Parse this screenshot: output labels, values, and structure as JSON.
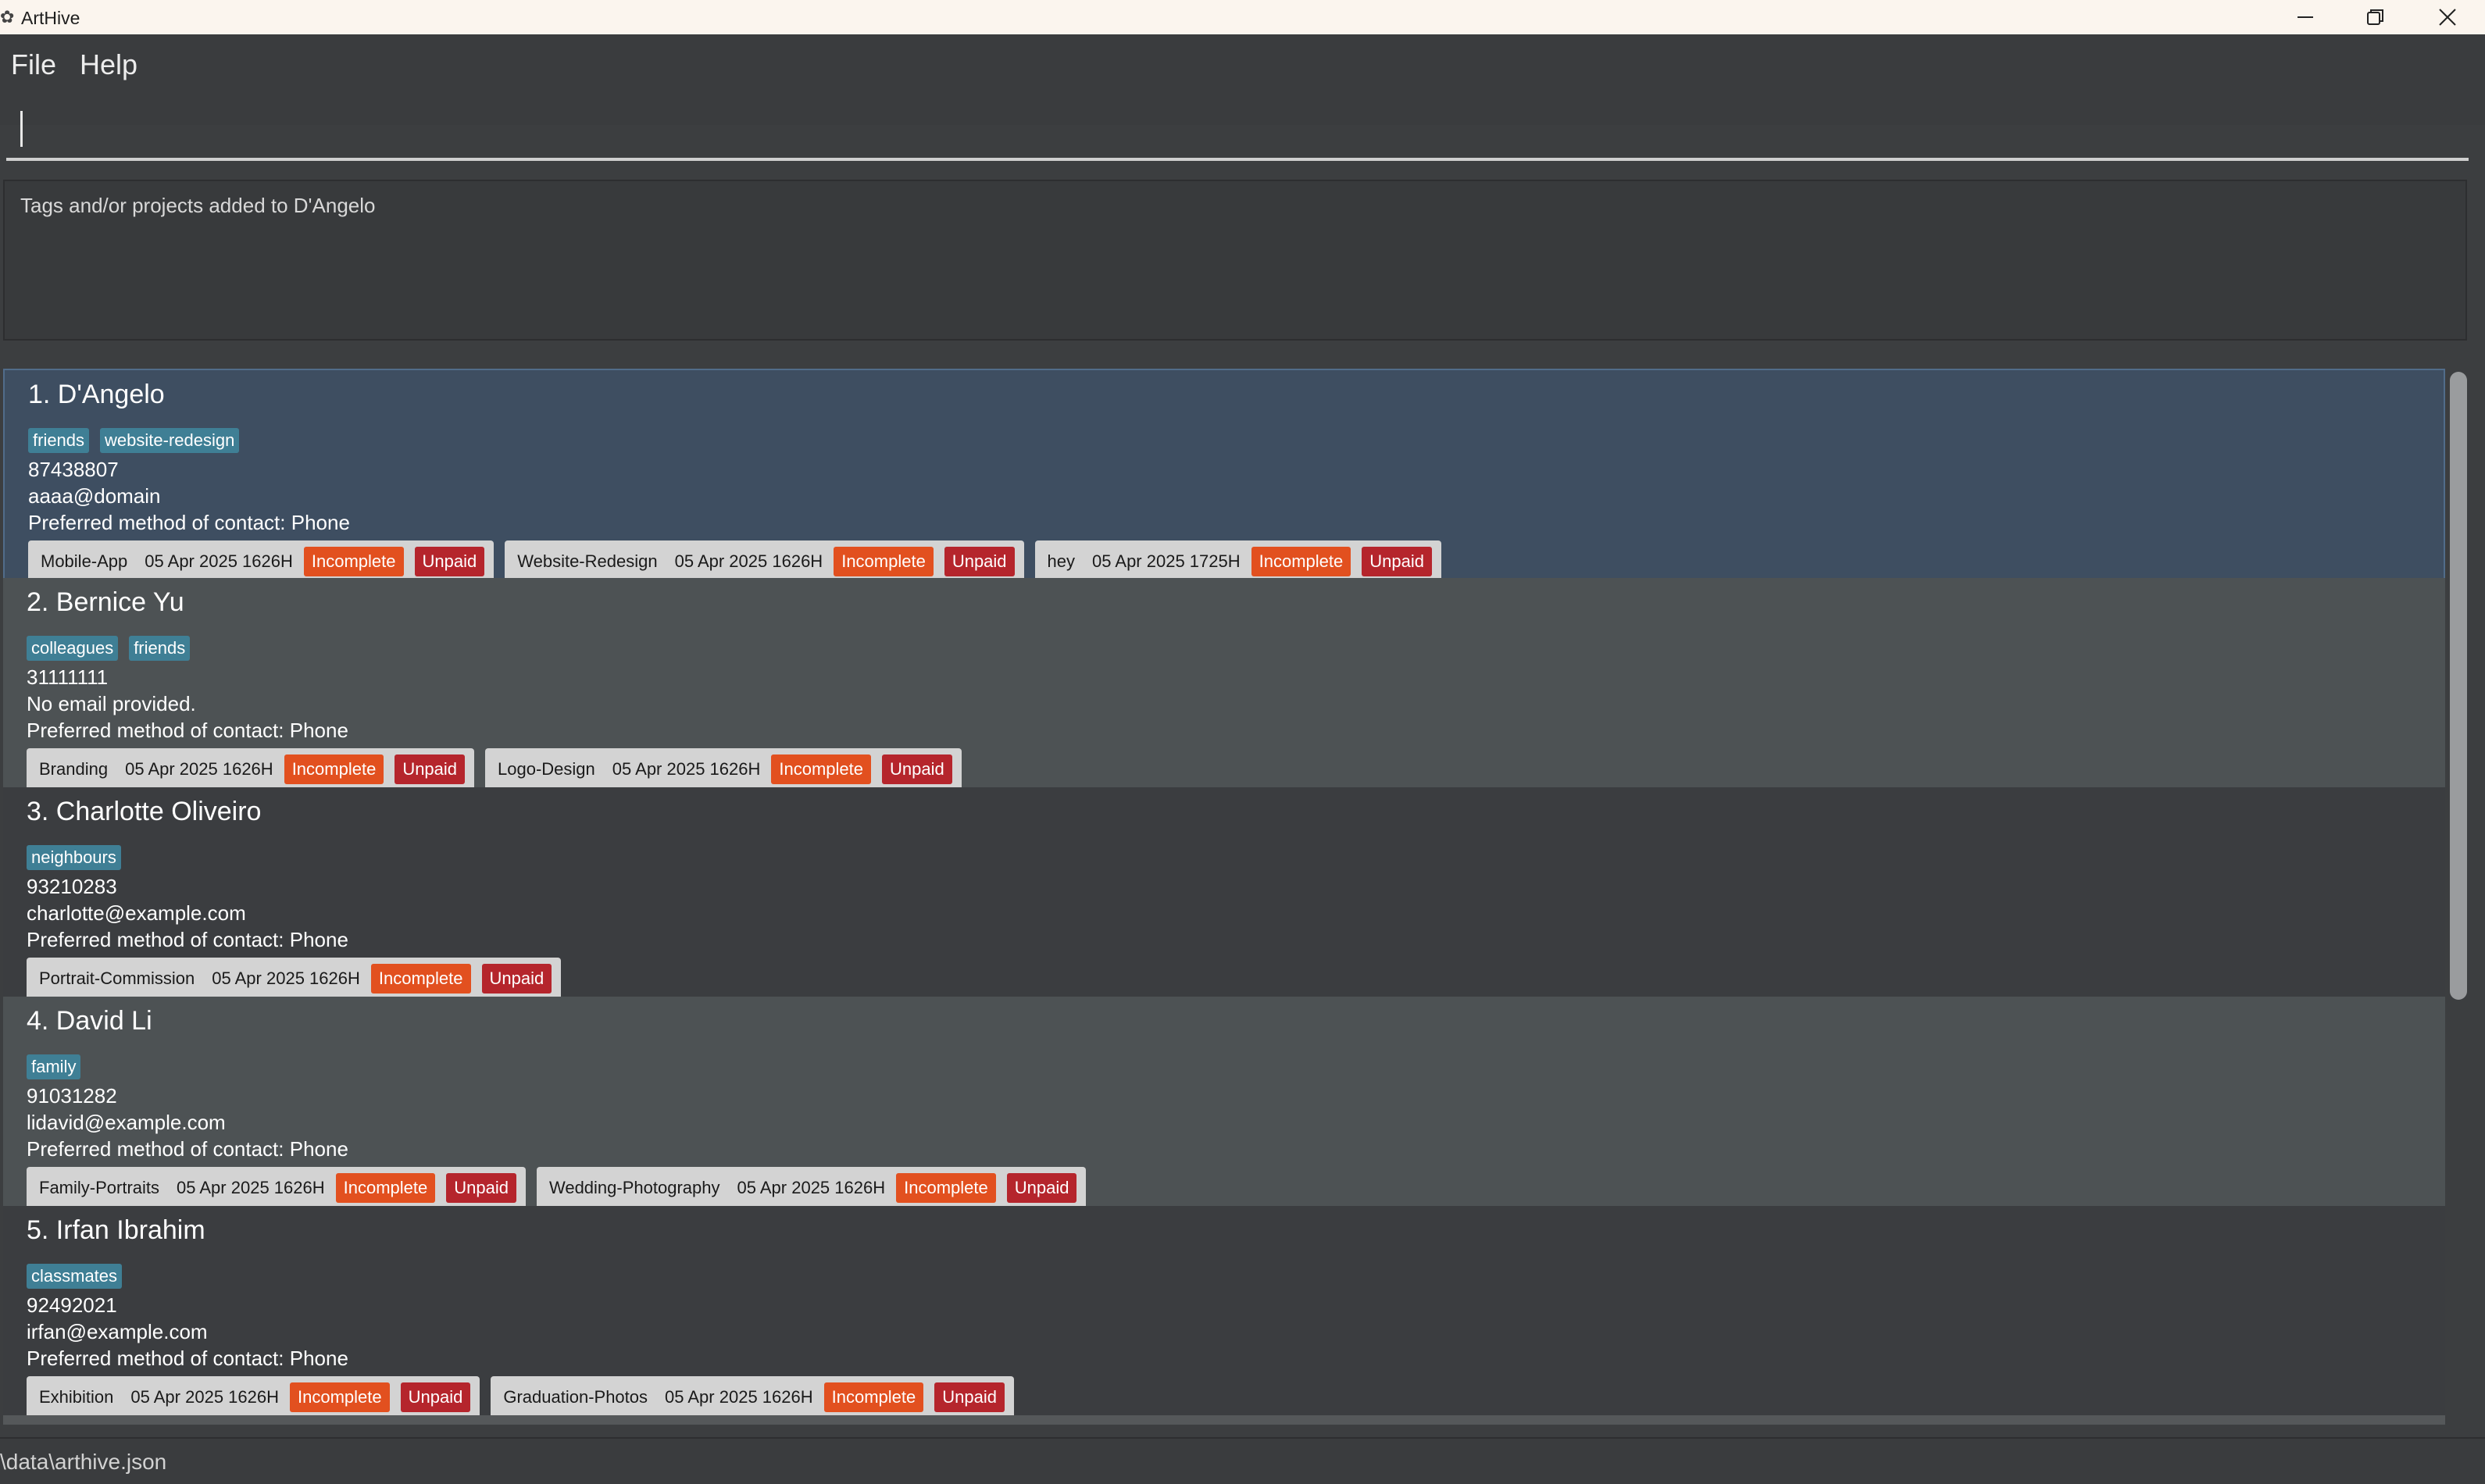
{
  "window": {
    "title": "ArtHive",
    "app_icon": "palette-icon"
  },
  "menu": {
    "file": "File",
    "help": "Help"
  },
  "command": {
    "value": ""
  },
  "result": {
    "message": "Tags and/or projects added to D'Angelo"
  },
  "persons": [
    {
      "name": "1. D'Angelo",
      "tags": [
        "friends",
        "website-redesign"
      ],
      "phone": "87438807",
      "email": "aaaa@domain",
      "contact": "Preferred method of contact: Phone",
      "projects": [
        {
          "name": "Mobile-App",
          "date": "05 Apr 2025 1626H",
          "status": "Incomplete",
          "payment": "Unpaid"
        },
        {
          "name": "Website-Redesign",
          "date": "05 Apr 2025 1626H",
          "status": "Incomplete",
          "payment": "Unpaid"
        },
        {
          "name": "hey",
          "date": "05 Apr 2025 1725H",
          "status": "Incomplete",
          "payment": "Unpaid"
        }
      ]
    },
    {
      "name": "2. Bernice Yu",
      "tags": [
        "colleagues",
        "friends"
      ],
      "phone": "31111111",
      "email": "No email provided.",
      "contact": "Preferred method of contact: Phone",
      "projects": [
        {
          "name": "Branding",
          "date": "05 Apr 2025 1626H",
          "status": "Incomplete",
          "payment": "Unpaid"
        },
        {
          "name": "Logo-Design",
          "date": "05 Apr 2025 1626H",
          "status": "Incomplete",
          "payment": "Unpaid"
        }
      ]
    },
    {
      "name": "3. Charlotte Oliveiro",
      "tags": [
        "neighbours"
      ],
      "phone": "93210283",
      "email": "charlotte@example.com",
      "contact": "Preferred method of contact: Phone",
      "projects": [
        {
          "name": "Portrait-Commission",
          "date": "05 Apr 2025 1626H",
          "status": "Incomplete",
          "payment": "Unpaid"
        }
      ]
    },
    {
      "name": "4. David Li",
      "tags": [
        "family"
      ],
      "phone": "91031282",
      "email": "lidavid@example.com",
      "contact": "Preferred method of contact: Phone",
      "projects": [
        {
          "name": "Family-Portraits",
          "date": "05 Apr 2025 1626H",
          "status": "Incomplete",
          "payment": "Unpaid"
        },
        {
          "name": "Wedding-Photography",
          "date": "05 Apr 2025 1626H",
          "status": "Incomplete",
          "payment": "Unpaid"
        }
      ]
    },
    {
      "name": "5. Irfan Ibrahim",
      "tags": [
        "classmates"
      ],
      "phone": "92492021",
      "email": "irfan@example.com",
      "contact": "Preferred method of contact: Phone",
      "projects": [
        {
          "name": "Exhibition",
          "date": "05 Apr 2025 1626H",
          "status": "Incomplete",
          "payment": "Unpaid"
        },
        {
          "name": "Graduation-Photos",
          "date": "05 Apr 2025 1626H",
          "status": "Incomplete",
          "payment": "Unpaid"
        }
      ]
    }
  ],
  "status_bar": {
    "path": "\\data\\arthive.json"
  },
  "colors": {
    "tag": "#3f7f95",
    "incomplete": "#e2501f",
    "unpaid": "#b5252c",
    "selected": "#3e4e61"
  }
}
